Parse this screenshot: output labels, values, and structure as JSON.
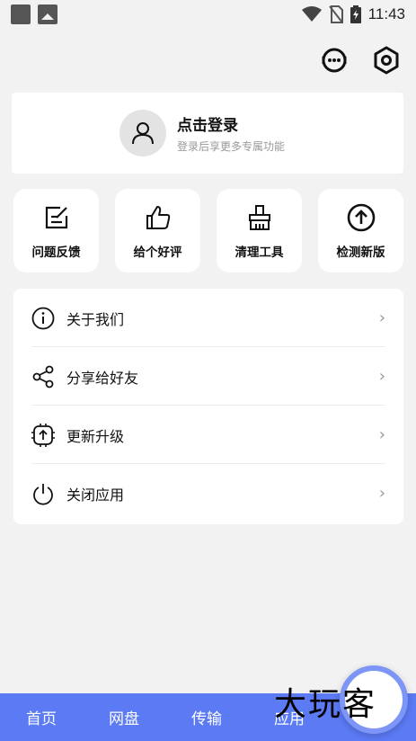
{
  "status_bar": {
    "time": "11:43"
  },
  "login": {
    "title": "点击登录",
    "subtitle": "登录后享更多专属功能"
  },
  "tiles": [
    {
      "label": "问题反馈",
      "icon": "edit-icon"
    },
    {
      "label": "给个好评",
      "icon": "thumbs-up-icon"
    },
    {
      "label": "清理工具",
      "icon": "broom-icon"
    },
    {
      "label": "检测新版",
      "icon": "arrow-up-circle-icon"
    }
  ],
  "menu": [
    {
      "label": "关于我们",
      "icon": "info-icon"
    },
    {
      "label": "分享给好友",
      "icon": "share-icon"
    },
    {
      "label": "更新升级",
      "icon": "update-icon"
    },
    {
      "label": "关闭应用",
      "icon": "power-icon"
    }
  ],
  "nav": [
    {
      "label": "首页"
    },
    {
      "label": "网盘"
    },
    {
      "label": "传输"
    },
    {
      "label": "应用"
    }
  ],
  "watermark": "大玩客",
  "colors": {
    "nav_bg": "#5b7af4",
    "background": "#f2f2f2"
  }
}
